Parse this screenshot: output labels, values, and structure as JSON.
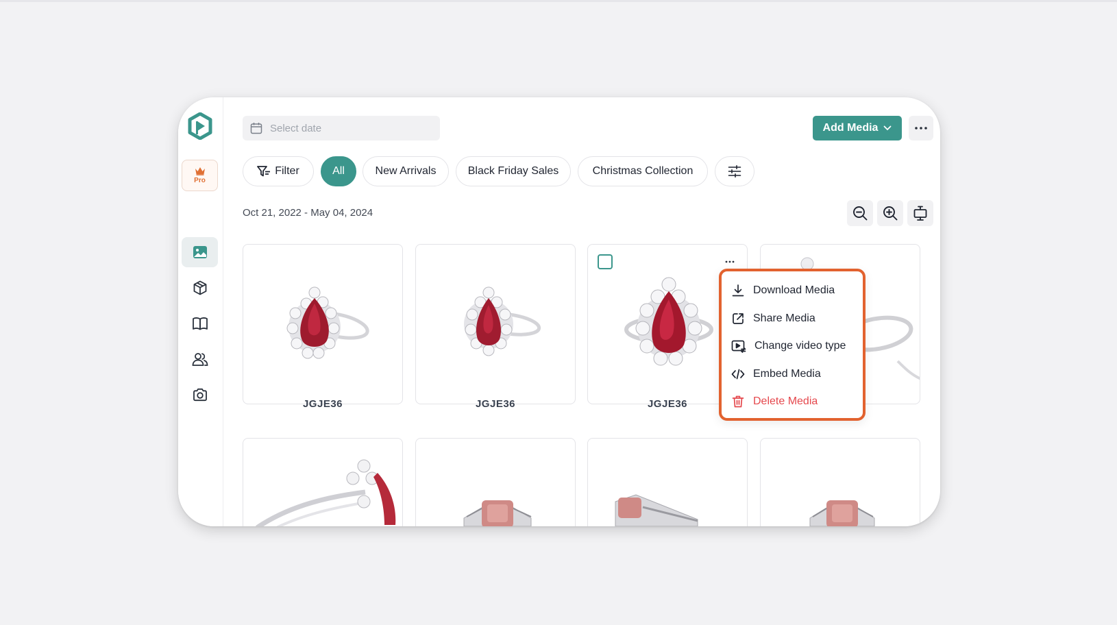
{
  "sidebar": {
    "pro_label": "Pro",
    "items": [
      {
        "name": "media",
        "icon": "image-icon",
        "active": true
      },
      {
        "name": "products",
        "icon": "cube-icon",
        "active": false
      },
      {
        "name": "catalogs",
        "icon": "book-icon",
        "active": false
      },
      {
        "name": "users",
        "icon": "users-icon",
        "active": false
      },
      {
        "name": "camera",
        "icon": "camera-icon",
        "active": false
      }
    ]
  },
  "header": {
    "date_placeholder": "Select date",
    "add_media_label": "Add Media"
  },
  "filters": {
    "filter_label": "Filter",
    "chips": [
      "All",
      "New Arrivals",
      "Black Friday Sales",
      "Christmas Collection"
    ],
    "active_chip": "All"
  },
  "date_range": "Oct 21, 2022 - May 04, 2024",
  "media": {
    "cards": [
      {
        "label": "JGJE36"
      },
      {
        "label": "JGJE36"
      },
      {
        "label": "JGJE36"
      },
      {
        "label": ""
      }
    ]
  },
  "context_menu": {
    "items": [
      {
        "label": "Download Media",
        "icon": "download-icon"
      },
      {
        "label": "Share Media",
        "icon": "share-icon"
      },
      {
        "label": "Change video type",
        "icon": "video-type-icon"
      },
      {
        "label": "Embed Media",
        "icon": "code-icon"
      },
      {
        "label": "Delete Media",
        "icon": "trash-icon",
        "danger": true
      }
    ]
  },
  "colors": {
    "accent": "#3b968c",
    "highlight": "#e2622f",
    "danger": "#e5484d",
    "pro": "#e07034"
  }
}
